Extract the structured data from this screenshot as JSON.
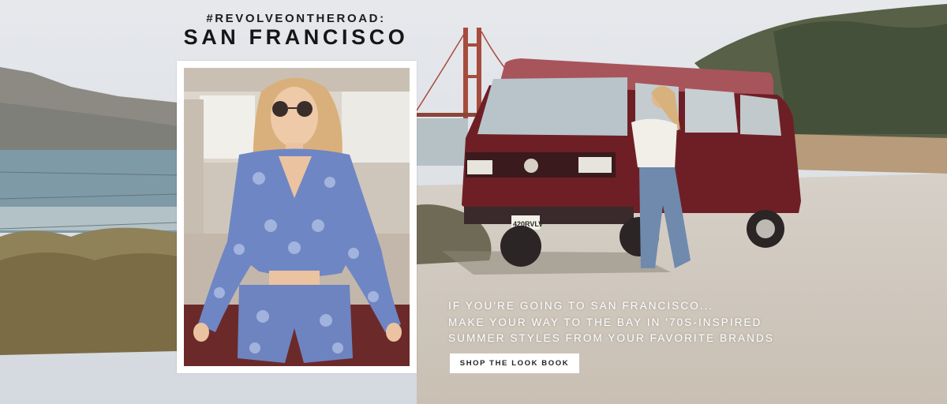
{
  "campaign": {
    "hashtag": "#REVOLVEONTHEROAD:",
    "city": "SAN FRANCISCO"
  },
  "tagline": {
    "lines": [
      "IF YOU'RE GOING TO SAN FRANCISCO...",
      "MAKE YOUR WAY TO THE BAY IN '70S-INSPIRED",
      "SUMMER STYLES FROM YOUR FAVORITE BRANDS"
    ]
  },
  "cta": {
    "label": "SHOP THE LOOK BOOK"
  },
  "scene": {
    "license_plate": "420RVLV"
  },
  "colors": {
    "sky": "#dfe3e8",
    "van_body": "#6e1f25",
    "van_roof": "#a8545b",
    "road": "#cfc7bd",
    "ocean": "#7e9aa6",
    "outfit_blue": "#6f86c4",
    "frame": "#ffffff",
    "text_dark": "#161616"
  }
}
